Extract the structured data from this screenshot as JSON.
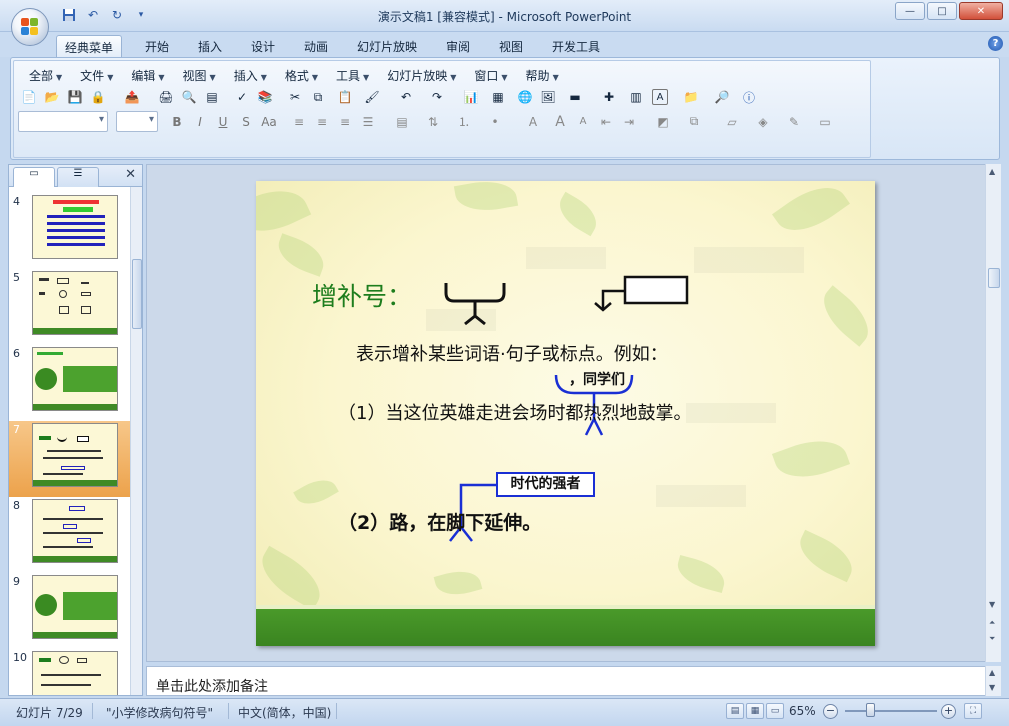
{
  "window": {
    "title": "演示文稿1 [兼容模式] - Microsoft PowerPoint",
    "controls": {
      "minimize": "—",
      "maximize": "□",
      "close": "✕"
    }
  },
  "ribbon": {
    "tabs": [
      "经典菜单",
      "开始",
      "插入",
      "设计",
      "动画",
      "幻灯片放映",
      "审阅",
      "视图",
      "开发工具"
    ],
    "active_tab": "经典菜单",
    "menus": [
      "全部",
      "文件",
      "编辑",
      "视图",
      "插入",
      "格式",
      "工具",
      "幻灯片放映",
      "窗口",
      "帮助"
    ],
    "help": "?"
  },
  "toolbar": {
    "bold": "B",
    "italic": "I",
    "underline": "U",
    "strike": "S",
    "font_case": "Aa",
    "font_size_grow": "A",
    "font_size_shrink": "A",
    "text_a": "A"
  },
  "panel": {
    "close": "✕",
    "slides": [
      {
        "num": "4"
      },
      {
        "num": "5"
      },
      {
        "num": "6"
      },
      {
        "num": "7",
        "selected": true
      },
      {
        "num": "8"
      },
      {
        "num": "9"
      },
      {
        "num": "10"
      }
    ]
  },
  "slide": {
    "title": "增补号：",
    "line1": "表示增补某些词语·句子或标点。例如：",
    "line2": "（1）当这位英雄走进会场时都热烈地鼓掌。",
    "insert1": "，同学们",
    "box_text": "时代的强者",
    "line3": "（2）路，在脚下延伸。"
  },
  "notes": {
    "placeholder": "单击此处添加备注"
  },
  "status": {
    "slide_info": "幻灯片 7/29",
    "theme": "\"小学修改病句符号\"",
    "language": "中文(简体，中国)",
    "zoom": "65%",
    "zoom_level": 0.3,
    "minus": "−",
    "plus": "+"
  }
}
